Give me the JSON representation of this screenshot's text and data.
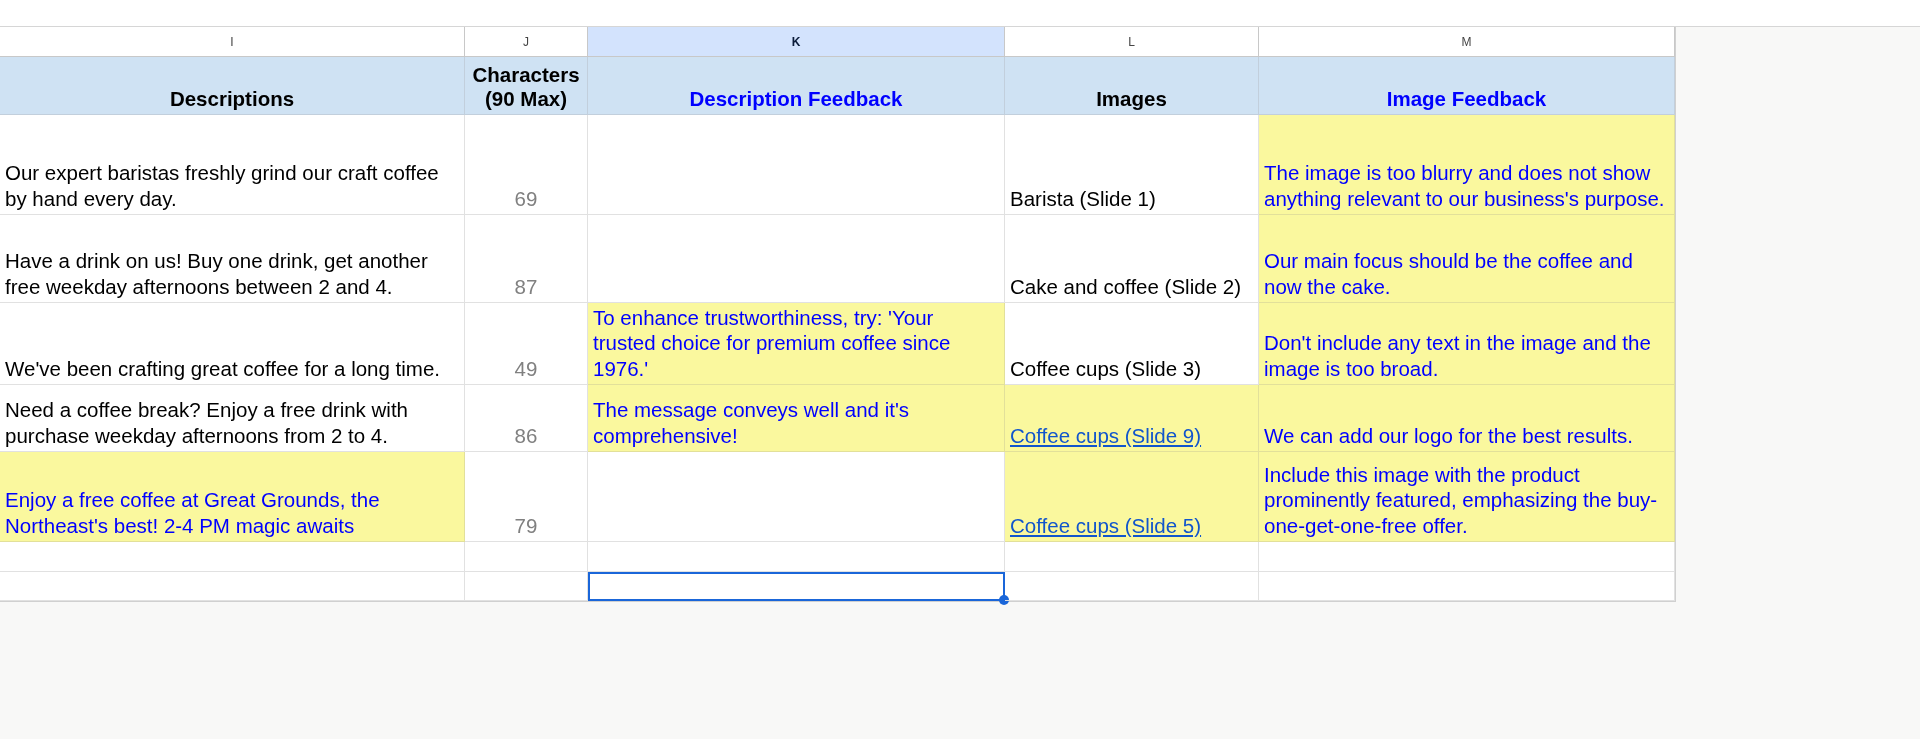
{
  "column_letters": [
    {
      "label": "I",
      "selected": false
    },
    {
      "label": "J",
      "selected": false
    },
    {
      "label": "K",
      "selected": true
    },
    {
      "label": "L",
      "selected": false
    },
    {
      "label": "M",
      "selected": false
    }
  ],
  "rows": [
    {
      "cells": [
        {
          "kind": "header",
          "text": "Descriptions",
          "highlighted": false,
          "selected": false
        },
        {
          "kind": "header",
          "text": "Characters (90 Max)",
          "highlighted": false,
          "selected": false
        },
        {
          "kind": "feedback-header",
          "text": "Description Feedback",
          "highlighted": false,
          "selected": false
        },
        {
          "kind": "header",
          "text": "Images",
          "highlighted": false,
          "selected": false
        },
        {
          "kind": "feedback-header",
          "text": "Image Feedback",
          "highlighted": false,
          "selected": false
        }
      ]
    },
    {
      "cells": [
        {
          "kind": "text",
          "text": "Our expert baristas freshly grind our craft coffee by hand every day.",
          "highlighted": false,
          "selected": false
        },
        {
          "kind": "count",
          "text": "69",
          "highlighted": false,
          "selected": false
        },
        {
          "kind": "empty",
          "highlighted": false,
          "selected": false
        },
        {
          "kind": "text",
          "text": "Barista (Slide 1)",
          "highlighted": false,
          "selected": false
        },
        {
          "kind": "feedback",
          "text": "The image is too blurry and does not show anything relevant to our business's purpose.",
          "highlighted": true,
          "selected": false
        }
      ]
    },
    {
      "cells": [
        {
          "kind": "text",
          "text": "Have a drink on us! Buy one drink, get another free weekday afternoons between 2 and 4.",
          "highlighted": false,
          "selected": false
        },
        {
          "kind": "count",
          "text": "87",
          "highlighted": false,
          "selected": false
        },
        {
          "kind": "empty",
          "highlighted": false,
          "selected": false
        },
        {
          "kind": "text",
          "text": "Cake and coffee (Slide 2)",
          "highlighted": false,
          "selected": false
        },
        {
          "kind": "feedback",
          "text": "Our main focus should be the coffee and now the cake.",
          "highlighted": true,
          "selected": false
        }
      ]
    },
    {
      "cells": [
        {
          "kind": "text",
          "text": "We've been crafting great coffee for a long time.",
          "highlighted": false,
          "selected": false
        },
        {
          "kind": "count",
          "text": "49",
          "highlighted": false,
          "selected": false
        },
        {
          "kind": "feedback",
          "text": "To enhance trustworthiness, try: 'Your trusted choice for premium coffee since 1976.'",
          "highlighted": true,
          "selected": false
        },
        {
          "kind": "text",
          "text": "Coffee cups (Slide 3)",
          "highlighted": false,
          "selected": false
        },
        {
          "kind": "feedback",
          "text": "Don't include any text in the image and the image is too broad.",
          "highlighted": true,
          "selected": false
        }
      ]
    },
    {
      "cells": [
        {
          "kind": "text",
          "text": "Need a coffee break? Enjoy a free drink with purchase weekday afternoons from 2 to 4.",
          "highlighted": false,
          "selected": false
        },
        {
          "kind": "count",
          "text": "86",
          "highlighted": false,
          "selected": false
        },
        {
          "kind": "feedback",
          "text": "The message conveys well and it's comprehensive!",
          "highlighted": true,
          "selected": false
        },
        {
          "kind": "link",
          "text": "Coffee cups (Slide 9)",
          "highlighted": true,
          "selected": false
        },
        {
          "kind": "feedback",
          "text": "We can add our logo for the best results.",
          "highlighted": true,
          "selected": false
        }
      ]
    },
    {
      "cells": [
        {
          "kind": "feedback",
          "text": "Enjoy a free coffee at Great Grounds, the Northeast's best! 2-4 PM magic awaits",
          "highlighted": true,
          "selected": false
        },
        {
          "kind": "count",
          "text": "79",
          "highlighted": false,
          "selected": false
        },
        {
          "kind": "empty",
          "highlighted": false,
          "selected": false
        },
        {
          "kind": "link",
          "text": "Coffee cups (Slide 5)",
          "highlighted": true,
          "selected": false
        },
        {
          "kind": "feedback",
          "text": "Include this image with the product prominently featured, emphasizing the buy-one-get-one-free offer.",
          "highlighted": true,
          "selected": false
        }
      ]
    },
    {
      "cells": [
        {
          "kind": "empty",
          "highlighted": false,
          "selected": false
        },
        {
          "kind": "empty",
          "highlighted": false,
          "selected": false
        },
        {
          "kind": "empty",
          "highlighted": false,
          "selected": false
        },
        {
          "kind": "empty",
          "highlighted": false,
          "selected": false
        },
        {
          "kind": "empty",
          "highlighted": false,
          "selected": false
        }
      ]
    },
    {
      "cells": [
        {
          "kind": "empty",
          "highlighted": false,
          "selected": false
        },
        {
          "kind": "empty",
          "highlighted": false,
          "selected": false
        },
        {
          "kind": "empty",
          "highlighted": false,
          "selected": true
        },
        {
          "kind": "empty",
          "highlighted": false,
          "selected": false
        },
        {
          "kind": "empty",
          "highlighted": false,
          "selected": false
        }
      ]
    }
  ]
}
